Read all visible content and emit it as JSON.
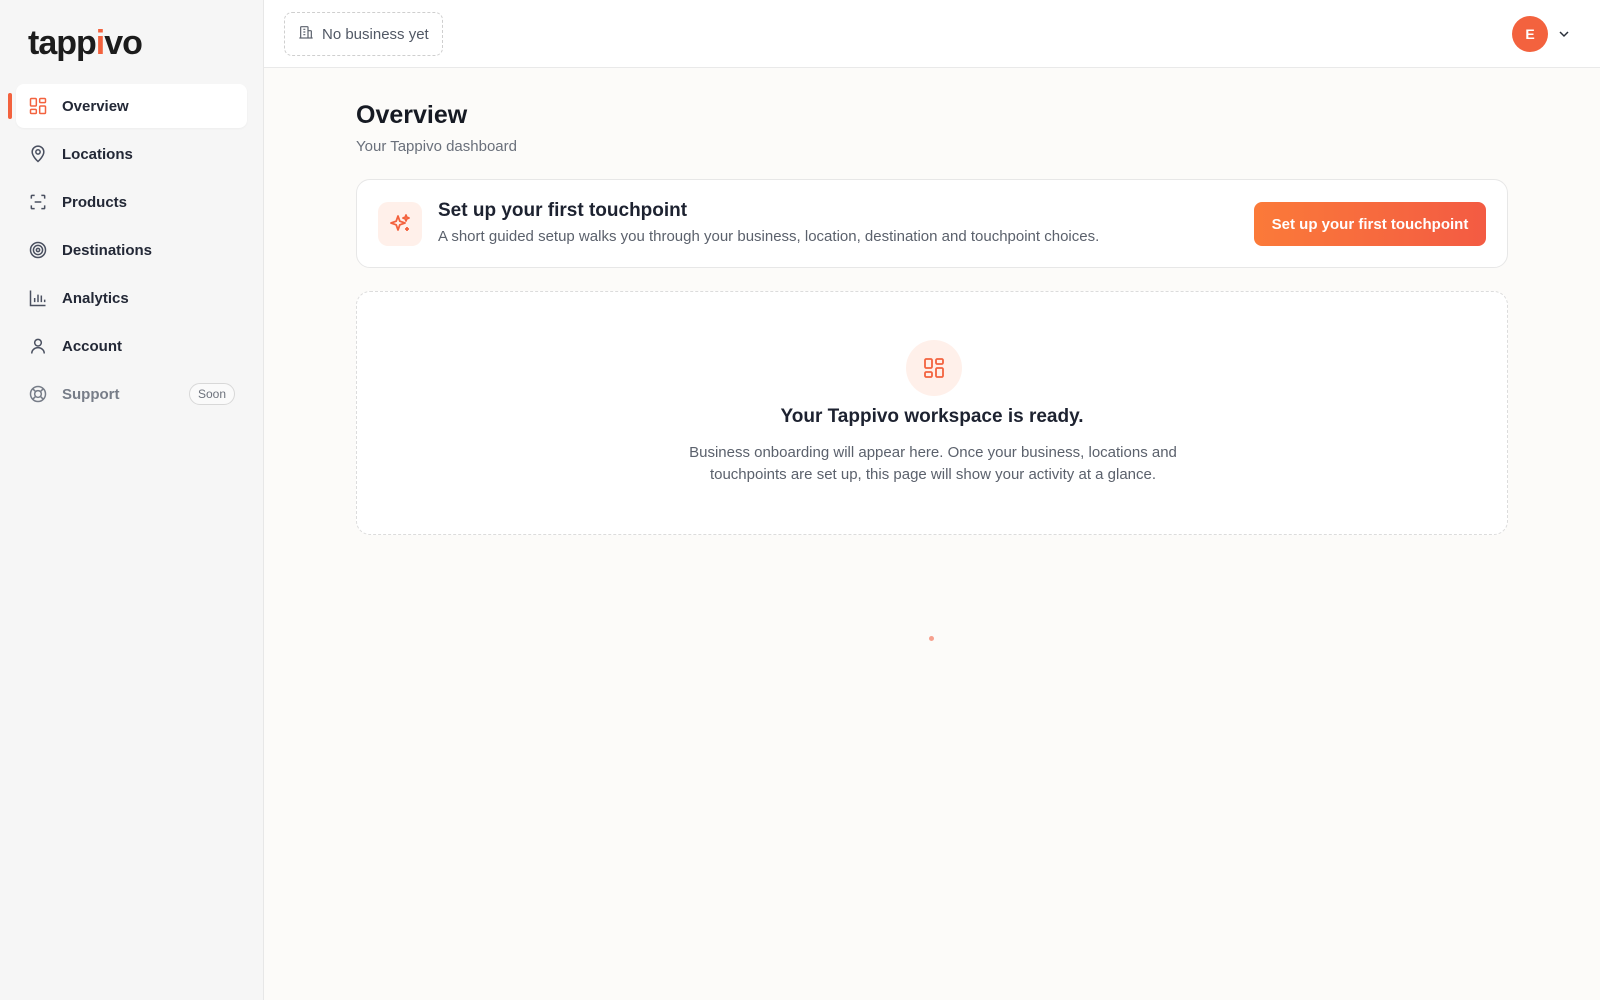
{
  "brand": {
    "logo_start": "tapp",
    "logo_accent": "i",
    "logo_end": "vo",
    "accent_color": "#f3623e"
  },
  "sidebar": {
    "items": [
      {
        "label": "Overview",
        "icon": "grid-icon",
        "active": true
      },
      {
        "label": "Locations",
        "icon": "map-pin-icon"
      },
      {
        "label": "Products",
        "icon": "scan-frame-icon"
      },
      {
        "label": "Destinations",
        "icon": "target-icon"
      },
      {
        "label": "Analytics",
        "icon": "bar-chart-icon"
      },
      {
        "label": "Account",
        "icon": "user-icon"
      },
      {
        "label": "Support",
        "icon": "lifebuoy-icon",
        "badge": "Soon",
        "disabled": true
      }
    ]
  },
  "header": {
    "business_label": "No business yet",
    "business_icon": "building-icon",
    "avatar_initial": "E"
  },
  "page": {
    "title": "Overview",
    "subtitle": "Your Tappivo dashboard"
  },
  "setup_card": {
    "title": "Set up your first touchpoint",
    "description": "A short guided setup walks you through your business, location, destination and touchpoint choices.",
    "button_label": "Set up your first touchpoint",
    "icon": "sparkles-icon"
  },
  "empty_state": {
    "icon": "grid-icon",
    "title": "Your Tappivo workspace is ready.",
    "description": "Business onboarding will appear here. Once your business, locations and touchpoints are set up, this page will show your activity at a glance."
  }
}
